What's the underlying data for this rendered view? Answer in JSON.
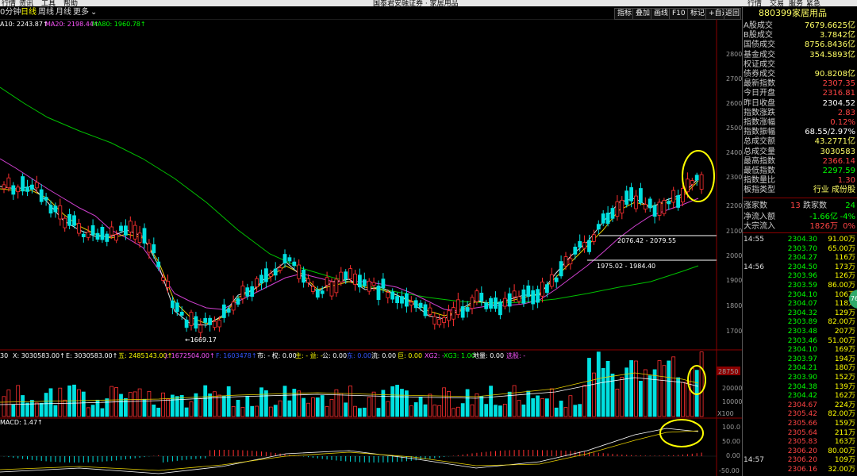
{
  "menu": {
    "items": [
      "行情",
      "资讯",
      "工具",
      "帮助"
    ],
    "title": "国泰君安融证券 · 家居用品",
    "right": [
      "行情",
      "交易",
      "服务",
      "紧急"
    ]
  },
  "toolbar": {
    "left": [
      "0分钟",
      "日线",
      "周线",
      "月线",
      "更多"
    ],
    "right": [
      "指标",
      "叠加",
      "画线",
      "F10",
      "标记",
      "+自选",
      "返回"
    ]
  },
  "ma_legend": [
    {
      "text": "A10: 2243.87↑",
      "color": "#ffffff"
    },
    {
      "text": "MA20: 2198.44↑",
      "color": "#ff55ff"
    },
    {
      "text": "MA80: 1960.78↑",
      "color": "#00ff00"
    }
  ],
  "price_axis": [
    "2800",
    "2700",
    "2600",
    "2500",
    "2400",
    "2300",
    "2200",
    "2100",
    "2000",
    "1900",
    "1800",
    "1700"
  ],
  "annotations": {
    "low": "←1669.17",
    "level1": "2076.42 - 2079.55",
    "level2": "1975.02 - 1984.40"
  },
  "volume_legend": [
    {
      "text": "30",
      "color": "#ffffff"
    },
    {
      "text": "X: 3030583.00↑",
      "color": "#ffffff"
    },
    {
      "text": "E: 3030583.00↑",
      "color": "#ffffff"
    },
    {
      "text": "五: 2485143.00↑",
      "color": "#ffff00"
    },
    {
      "text": "J: 1672504.00↑",
      "color": "#ff55ff"
    },
    {
      "text": "F: 1603478↑",
      "color": "#3355ff"
    },
    {
      "text": "市: - 权: 0.00",
      "color": "#ffffff"
    },
    {
      "text": "主: - 益: -",
      "color": "#ffff00"
    },
    {
      "text": "公: 0.00",
      "color": "#ffffff"
    },
    {
      "text": "东: 0.00",
      "color": "#3355ff"
    },
    {
      "text": "流: 0.00",
      "color": "#ffffff"
    },
    {
      "text": "巨: 0.00",
      "color": "#ffff00"
    },
    {
      "text": "XG2: -",
      "color": "#ff55ff"
    },
    {
      "text": "XG3: 1.00",
      "color": "#00ff00"
    },
    {
      "text": "地量: 0.00",
      "color": "#ffffff"
    },
    {
      "text": "选股: -",
      "color": "#ff55ff"
    }
  ],
  "volume_axis": {
    "current": "28750",
    "ticks": [
      "20000",
      "10000"
    ],
    "unit": "X100"
  },
  "macd_legend": {
    "text": "MACD: 1.47↑"
  },
  "macd_axis": [
    "100.0",
    "50.00",
    "0.00",
    "-50.00"
  ],
  "side": {
    "code": "880399",
    "name": "家居用品",
    "rows": [
      {
        "label": "A股成交",
        "value": "7679.6625亿",
        "color": "#ffff66"
      },
      {
        "label": "B股成交",
        "value": "3.7842亿",
        "color": "#ffff66"
      },
      {
        "label": "国债成交",
        "value": "8756.8436亿",
        "color": "#ffff66"
      },
      {
        "label": "基金成交",
        "value": "354.5893亿",
        "color": "#ffff66"
      },
      {
        "label": "权证成交",
        "value": "",
        "color": "#ffff66"
      },
      {
        "label": "债券成交",
        "value": "90.8208亿",
        "color": "#ffff66"
      },
      {
        "label": "最新指数",
        "value": "2307.35",
        "color": "#ff4444"
      },
      {
        "label": "今日开盘",
        "value": "2316.81",
        "color": "#ff4444"
      },
      {
        "label": "昨日收盘",
        "value": "2304.52",
        "color": "#ffffff"
      },
      {
        "label": "指数涨跌",
        "value": "2.83",
        "color": "#ff4444"
      },
      {
        "label": "指数涨幅",
        "value": "0.12%",
        "color": "#ff4444"
      },
      {
        "label": "指数振幅",
        "value": "68.55/2.97%",
        "color": "#ffffff"
      },
      {
        "label": "总成交额",
        "value": "43.2771亿",
        "color": "#ffff66"
      },
      {
        "label": "总成交量",
        "value": "3030583",
        "color": "#ffff66"
      },
      {
        "label": "最高指数",
        "value": "2366.14",
        "color": "#ff4444"
      },
      {
        "label": "最低指数",
        "value": "2297.59",
        "color": "#00ff00"
      },
      {
        "label": "指数量比",
        "value": "1.30",
        "color": "#ff4444"
      },
      {
        "label": "板指类型",
        "value": "行业 成份股",
        "color": "#ffff66"
      }
    ],
    "updown": {
      "up_label": "涨家数",
      "up": "13",
      "down_label": "跌家数",
      "down": "24"
    },
    "flow": [
      {
        "label": "净流入额",
        "v1": "-1.66亿",
        "v1c": "#00ff00",
        "v2": "-4%",
        "v2c": "#00ff00"
      },
      {
        "label": "大宗流入",
        "v1": "1826万",
        "v1c": "#ff4444",
        "v2": "0%",
        "v2c": "#ff4444"
      }
    ],
    "ticks": [
      {
        "time": "14:55",
        "price": "2304.30",
        "pc": "#00ff00",
        "vol": "91.00万"
      },
      {
        "time": "",
        "price": "2303.70",
        "pc": "#00ff00",
        "vol": "65.00万"
      },
      {
        "time": "",
        "price": "2304.27",
        "pc": "#00ff00",
        "vol": "116万"
      },
      {
        "time": "14:56",
        "price": "2304.50",
        "pc": "#00ff00",
        "vol": "173万"
      },
      {
        "time": "",
        "price": "2303.96",
        "pc": "#00ff00",
        "vol": "126万"
      },
      {
        "time": "",
        "price": "2303.59",
        "pc": "#00ff00",
        "vol": "86.00万"
      },
      {
        "time": "",
        "price": "2304.10",
        "pc": "#00ff00",
        "vol": "106万"
      },
      {
        "time": "",
        "price": "2304.07",
        "pc": "#00ff00",
        "vol": "118万"
      },
      {
        "time": "",
        "price": "2304.32",
        "pc": "#00ff00",
        "vol": "129万"
      },
      {
        "time": "",
        "price": "2303.89",
        "pc": "#00ff00",
        "vol": "82.00万"
      },
      {
        "time": "",
        "price": "2303.48",
        "pc": "#00ff00",
        "vol": "207万"
      },
      {
        "time": "",
        "price": "2303.46",
        "pc": "#00ff00",
        "vol": "51.00万"
      },
      {
        "time": "",
        "price": "2304.10",
        "pc": "#00ff00",
        "vol": "169万"
      },
      {
        "time": "",
        "price": "2303.97",
        "pc": "#00ff00",
        "vol": "194万"
      },
      {
        "time": "",
        "price": "2304.21",
        "pc": "#00ff00",
        "vol": "180万"
      },
      {
        "time": "",
        "price": "2303.90",
        "pc": "#00ff00",
        "vol": "152万"
      },
      {
        "time": "",
        "price": "2304.38",
        "pc": "#00ff00",
        "vol": "139万"
      },
      {
        "time": "",
        "price": "2304.42",
        "pc": "#00ff00",
        "vol": "162万"
      },
      {
        "time": "",
        "price": "2304.67",
        "pc": "#ff4444",
        "vol": "224万"
      },
      {
        "time": "",
        "price": "2305.42",
        "pc": "#ff4444",
        "vol": "82.00万"
      },
      {
        "time": "",
        "price": "2305.66",
        "pc": "#ff4444",
        "vol": "159万"
      },
      {
        "time": "",
        "price": "2305.64",
        "pc": "#ff4444",
        "vol": "211万"
      },
      {
        "time": "",
        "price": "2305.83",
        "pc": "#ff4444",
        "vol": "163万"
      },
      {
        "time": "",
        "price": "2306.20",
        "pc": "#ff4444",
        "vol": "80.00万"
      },
      {
        "time": "14:57",
        "price": "2306.20",
        "pc": "#ff4444",
        "vol": "109万"
      },
      {
        "time": "",
        "price": "2306.16",
        "pc": "#ff4444",
        "vol": "32.00万"
      }
    ]
  },
  "side_badge": "76"
}
